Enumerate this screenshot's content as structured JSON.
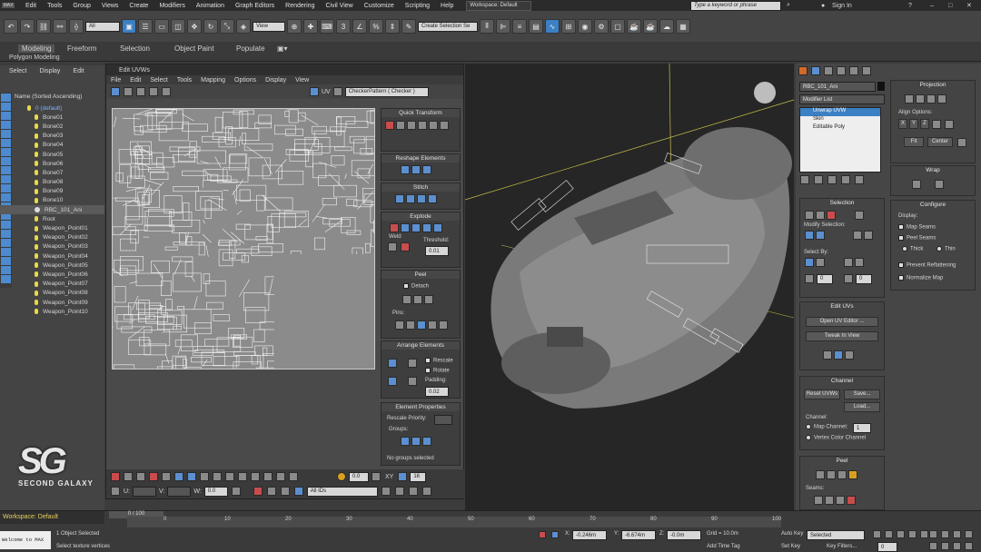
{
  "app": {
    "logo": "MAX",
    "workspace_label": "Workspace: Default",
    "search_placeholder": "Type a keyword or phrase",
    "sign_in": "Sign In"
  },
  "menu": [
    "Edit",
    "Tools",
    "Group",
    "Views",
    "Create",
    "Modifiers",
    "Animation",
    "Graph Editors",
    "Rendering",
    "Civil View",
    "Customize",
    "Scripting",
    "Help"
  ],
  "toolbar": {
    "filter_value": "All",
    "view_value": "View",
    "selection_set": "Create Selection Se"
  },
  "ribbon": {
    "tabs": [
      "Modeling",
      "Freeform",
      "Selection",
      "Object Paint",
      "Populate"
    ],
    "sub_label": "Polygon Modeling"
  },
  "scene_explorer": {
    "menu": [
      "Select",
      "Display",
      "Edit"
    ],
    "header": "Name (Sorted Ascending)",
    "items": [
      "0 (default)",
      "Bone01",
      "Bone02",
      "Bone03",
      "Bone04",
      "Bone05",
      "Bone06",
      "Bone07",
      "Bone08",
      "Bone09",
      "Bone10",
      "RBC_101_Ani",
      "Root",
      "Weapon_Point01",
      "Weapon_Point02",
      "Weapon_Point03",
      "Weapon_Point04",
      "Weapon_Point05",
      "Weapon_Point06",
      "Weapon_Point07",
      "Weapon_Point08",
      "Weapon_Point09",
      "Weapon_Point10"
    ]
  },
  "uv_editor": {
    "title": "Edit UVWs",
    "menu": [
      "File",
      "Edit",
      "Select",
      "Tools",
      "Mapping",
      "Options",
      "Display",
      "View"
    ],
    "uv_label": "UV",
    "pattern": "CheckerPattern  ( Checker )",
    "panels": {
      "quick_transform": "Quick Transform",
      "reshape": "Reshape Elements",
      "stitch": "Stitch",
      "explode": "Explode",
      "weld": "Weld",
      "threshold_label": "Threshold:",
      "threshold_value": "0.01",
      "peel": "Peel",
      "detach": "Detach",
      "pins": "Pins:",
      "arrange": "Arrange Elements",
      "rescale": "Rescale",
      "rotate": "Rotate",
      "padding_label": "Padding:",
      "padding_value": "0.02",
      "element_properties": "Element Properties",
      "rescale_priority": "Rescale Priority:",
      "groups": "Groups:",
      "no_groups": "No groups selected"
    },
    "bottom": {
      "u_label": "U:",
      "v_label": "V:",
      "w_label": "W:",
      "u_value": "",
      "v_value": "",
      "w_value": "0.0",
      "value1": "0.0",
      "xy": "XY",
      "grid_value": "16",
      "ids": "All IDs"
    }
  },
  "command_panel": {
    "object_name": "RBC_101_Ani",
    "modifier_list": "Modifier List",
    "stack": [
      "Unwrap UVW",
      "Skin",
      "Editable Poly"
    ],
    "projection": {
      "title": "Projection",
      "align_options": "Align Options:",
      "axes": [
        "X",
        "Y",
        "Z"
      ],
      "fit": "Fit",
      "center": "Center"
    },
    "wrap": "Wrap",
    "configure": {
      "title": "Configure",
      "display": "Display:",
      "map_seams": "Map Seams",
      "peel_seams": "Peel Seams",
      "thick": "Thick",
      "thin": "Thin",
      "prevent_reflattening": "Prevent Reflattening",
      "normalize_map": "Normalize Map"
    },
    "selection": {
      "title": "Selection",
      "modify_selection": "Modify Selection:",
      "select_by": "Select By:",
      "value1": "0",
      "value2": "0"
    },
    "edit_uvs": {
      "title": "Edit UVs",
      "open_editor": "Open UV Editor ...",
      "tweak": "Tweak In View"
    },
    "channel": {
      "title": "Channel",
      "reset": "Reset UVWs",
      "save": "Save...",
      "load": "Load...",
      "channel_label": "Channel:",
      "map_channel": "Map Channel:",
      "map_channel_value": "1",
      "vertex_color": "Vertex Color Channel"
    },
    "peel": {
      "title": "Peel",
      "seams": "Seams:"
    }
  },
  "watermark": {
    "logo": "SG",
    "text": "SECOND GALAXY"
  },
  "status": {
    "workspace": "Workspace: Default",
    "frame": "0 / 100",
    "ticks": [
      "0",
      "10",
      "20",
      "30",
      "40",
      "50",
      "60",
      "70",
      "80",
      "90",
      "100"
    ],
    "objects_selected": "1 Object Selected",
    "prompt": "Select texture vertices",
    "welcome": "Welcome to MAX",
    "x_label": "X:",
    "x_value": "-0.246m",
    "y_label": "Y:",
    "y_value": "-6.674m",
    "z_label": "Z:",
    "z_value": "-0.0m",
    "grid": "Grid = 10.0m",
    "add_time_tag": "Add Time Tag",
    "auto_key": "Auto Key",
    "set_key": "Set Key",
    "selected": "Selected",
    "key_filters": "Key Filters...",
    "frame_field": "0"
  }
}
